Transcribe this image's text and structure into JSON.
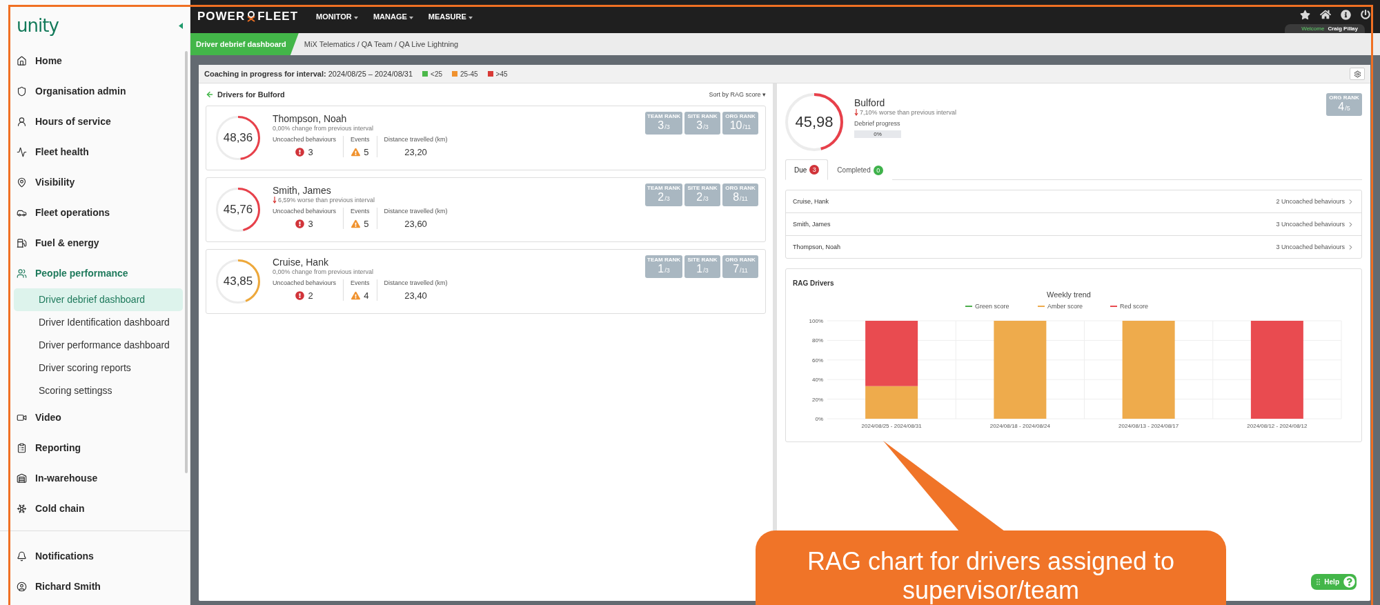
{
  "sidebar": {
    "logo": "unity",
    "items": [
      {
        "label": "Home",
        "selected": false
      },
      {
        "label": "Organisation admin",
        "selected": false
      },
      {
        "label": "Hours of service",
        "selected": false
      },
      {
        "label": "Fleet health",
        "selected": false
      },
      {
        "label": "Visibility",
        "selected": false
      },
      {
        "label": "Fleet operations",
        "selected": false
      },
      {
        "label": "Fuel & energy",
        "selected": false
      },
      {
        "label": "People performance",
        "selected": true,
        "children": [
          {
            "label": "Driver debrief dashboard",
            "selected": true
          },
          {
            "label": "Driver Identification dashboard",
            "selected": false
          },
          {
            "label": "Driver performance dashboard",
            "selected": false
          },
          {
            "label": "Driver scoring reports",
            "selected": false
          },
          {
            "label": "Scoring settingss",
            "selected": false
          }
        ]
      },
      {
        "label": "Video",
        "selected": false
      },
      {
        "label": "Reporting",
        "selected": false
      },
      {
        "label": "In-warehouse",
        "selected": false
      },
      {
        "label": "Cold chain",
        "selected": false
      }
    ],
    "footer": [
      {
        "label": "Notifications"
      },
      {
        "label": "Richard Smith"
      }
    ]
  },
  "topbar": {
    "logo_left": "POWER",
    "logo_right": "FLEET",
    "menus": [
      {
        "label": "MONITOR"
      },
      {
        "label": "MANAGE"
      },
      {
        "label": "MEASURE"
      }
    ],
    "welcome": "Welcome",
    "user": "Craig Pillay"
  },
  "breadcrumb": {
    "current": "Driver debrief dashboard",
    "path": "MiX Telematics / QA Team / QA Live Lightning"
  },
  "header": {
    "label": "Coaching in progress for interval:",
    "interval": "2024/08/25 – 2024/08/31",
    "legend": [
      {
        "label": "<25",
        "color": "#4cb84a"
      },
      {
        "label": "25-45",
        "color": "#f0922e"
      },
      {
        "label": ">45",
        "color": "#d83a36"
      }
    ]
  },
  "drivers_panel": {
    "title": "Drivers for Bulford",
    "sort": "Sort by RAG score",
    "sort_caret": "▾",
    "drivers": [
      {
        "name": "Thompson, Noah",
        "score": "48,36",
        "level": 0.48,
        "color": "#e8404a",
        "change": "0,00% change from previous interval",
        "worse": false,
        "stats": [
          {
            "kind": "alert",
            "label": "Uncoached behaviours",
            "value": "3"
          },
          {
            "kind": "warning",
            "label": "Events",
            "value": "5"
          },
          {
            "kind": "plain",
            "label": "Distance travelled (km)",
            "value": "23,20"
          }
        ],
        "ranks": [
          {
            "label": "TEAM RANK",
            "value": "3",
            "total": "/3"
          },
          {
            "label": "SITE RANK",
            "value": "3",
            "total": "/3"
          },
          {
            "label": "ORG RANK",
            "value": "10",
            "total": "/11"
          }
        ]
      },
      {
        "name": "Smith, James",
        "score": "45,76",
        "level": 0.46,
        "color": "#e8404a",
        "change": "6,59% worse than previous interval",
        "worse": true,
        "stats": [
          {
            "kind": "alert",
            "label": "Uncoached behaviours",
            "value": "3"
          },
          {
            "kind": "warning",
            "label": "Events",
            "value": "5"
          },
          {
            "kind": "plain",
            "label": "Distance travelled (km)",
            "value": "23,60"
          }
        ],
        "ranks": [
          {
            "label": "TEAM RANK",
            "value": "2",
            "total": "/3"
          },
          {
            "label": "SITE RANK",
            "value": "2",
            "total": "/3"
          },
          {
            "label": "ORG RANK",
            "value": "8",
            "total": "/11"
          }
        ]
      },
      {
        "name": "Cruise, Hank",
        "score": "43,85",
        "level": 0.44,
        "color": "#eea83a",
        "change": "0,00% change from previous interval",
        "worse": false,
        "stats": [
          {
            "kind": "alert",
            "label": "Uncoached behaviours",
            "value": "2"
          },
          {
            "kind": "warning",
            "label": "Events",
            "value": "4"
          },
          {
            "kind": "plain",
            "label": "Distance travelled (km)",
            "value": "23,40"
          }
        ],
        "ranks": [
          {
            "label": "TEAM RANK",
            "value": "1",
            "total": "/3"
          },
          {
            "label": "SITE RANK",
            "value": "1",
            "total": "/3"
          },
          {
            "label": "ORG RANK",
            "value": "7",
            "total": "/11"
          }
        ]
      }
    ]
  },
  "site": {
    "score": "45,98",
    "level": 0.46,
    "color": "#e8404a",
    "name": "Bulford",
    "change": "7,10% worse than previous interval",
    "worse": true,
    "progress_label": "Debrief progress",
    "progress": {
      "level": 0,
      "reading": "0%"
    },
    "rank": {
      "label": "ORG RANK",
      "value": "4",
      "total": "/5"
    },
    "tabs": [
      {
        "label": "Due",
        "count": "3",
        "color": "#d1343a",
        "selected": true
      },
      {
        "label": "Completed",
        "count": "0",
        "color": "#3fb24b",
        "selected": false
      }
    ],
    "due_list": [
      {
        "name": "Cruise, Hank",
        "detail": "2 Uncoached behaviours"
      },
      {
        "name": "Smith, James",
        "detail": "3 Uncoached behaviours"
      },
      {
        "name": "Thompson, Noah",
        "detail": "3 Uncoached behaviours"
      }
    ]
  },
  "chart_card": {
    "title": "RAG Drivers",
    "chart_data": {
      "type": "bar",
      "title": "Weekly trend",
      "categories": [
        "2024/08/25 - 2024/08/31",
        "2024/08/18 - 2024/08/24",
        "2024/08/13 - 2024/08/17",
        "2024/08/12 - 2024/08/12"
      ],
      "series": [
        {
          "name": "Green score",
          "color": "#4cae4c",
          "values": [
            0,
            0,
            0,
            0
          ]
        },
        {
          "name": "Amber score",
          "color": "#eeab4c",
          "values": [
            33.3,
            100,
            100,
            0
          ]
        },
        {
          "name": "Red score",
          "color": "#e94b50",
          "values": [
            66.7,
            0,
            0,
            100
          ]
        }
      ],
      "grid": true,
      "legend": true,
      "ylim": [
        0,
        100
      ],
      "yticks": [
        {
          "value": 0,
          "label": "0%"
        },
        {
          "value": 20,
          "label": "20%"
        },
        {
          "value": 40,
          "label": "40%"
        },
        {
          "value": 60,
          "label": "60%"
        },
        {
          "value": 80,
          "label": "80%"
        },
        {
          "value": 100,
          "label": "100%"
        }
      ],
      "stacked": true
    }
  },
  "help": {
    "label": "Help"
  },
  "callout": {
    "text": "RAG chart for drivers assigned to supervisor/team"
  }
}
